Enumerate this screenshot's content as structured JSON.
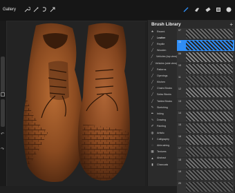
{
  "toolbar": {
    "gallery_label": "Gallery",
    "left_icons": [
      "wrench-icon",
      "wand-icon",
      "selection-icon",
      "arrow-icon"
    ],
    "right_icons": [
      "brush-icon",
      "smudge-icon",
      "eraser-icon",
      "layers-icon",
      "color-dot-icon"
    ],
    "accent": "#2f8df5"
  },
  "panel": {
    "title": "Brush Library",
    "add_label": "+",
    "categories": [
      {
        "label": "Recent",
        "icon": "star-icon"
      },
      {
        "label": "Leather",
        "icon": "stroke-icon"
      },
      {
        "label": "Reptile",
        "icon": "stroke-icon"
      },
      {
        "label": "Wooden",
        "icon": "stroke-icon"
      },
      {
        "label": "Vehicles (top view)",
        "icon": "stroke-icon"
      },
      {
        "label": "Vehicles (side view)",
        "icon": "stroke-icon"
      },
      {
        "label": "Patterns",
        "icon": "stroke-icon"
      },
      {
        "label": "Openings",
        "icon": "stroke-icon"
      },
      {
        "label": "Kitchen",
        "icon": "stroke-icon"
      },
      {
        "label": "Chairs Blocks",
        "icon": "stroke-icon"
      },
      {
        "label": "Sofas Blocks",
        "icon": "stroke-icon"
      },
      {
        "label": "Tables Blocks",
        "icon": "stroke-icon"
      },
      {
        "label": "Sketching",
        "icon": "pencil-icon"
      },
      {
        "label": "Inking",
        "icon": "pen-icon"
      },
      {
        "label": "Drawing",
        "icon": "swirl-icon"
      },
      {
        "label": "Painting",
        "icon": "brush-icon"
      },
      {
        "label": "Artistic",
        "icon": "palette-icon"
      },
      {
        "label": "Calligraphy",
        "icon": "calligraphy-icon"
      },
      {
        "label": "Airbrushing",
        "icon": "airbrush-icon"
      },
      {
        "label": "Textures",
        "icon": "grid-icon"
      },
      {
        "label": "Abstract",
        "icon": "triangle-icon"
      },
      {
        "label": "Charcoals",
        "icon": "charcoal-icon"
      }
    ],
    "selected_category_index": 1,
    "brushes": [
      {
        "num": "07",
        "color": "#6b6b6b"
      },
      {
        "num": "08",
        "color": "#2f8df5"
      },
      {
        "num": "09",
        "color": "#8a8a8a"
      },
      {
        "num": "10",
        "color": "#777777"
      },
      {
        "num": "11",
        "color": "#5c5c5c"
      },
      {
        "num": "12",
        "color": "#808080"
      },
      {
        "num": "13",
        "color": "#6e6e6e"
      },
      {
        "num": "14",
        "color": "#7a7a7a"
      },
      {
        "num": "15",
        "color": "#6a6a6a"
      },
      {
        "num": "16",
        "color": "#777777"
      },
      {
        "num": "17",
        "color": "#5f5f5f"
      },
      {
        "num": "18",
        "color": "#727272"
      },
      {
        "num": "19",
        "color": "#666666"
      },
      {
        "num": "20",
        "color": "#5a5a5a"
      }
    ],
    "selected_brush_index": 1
  }
}
